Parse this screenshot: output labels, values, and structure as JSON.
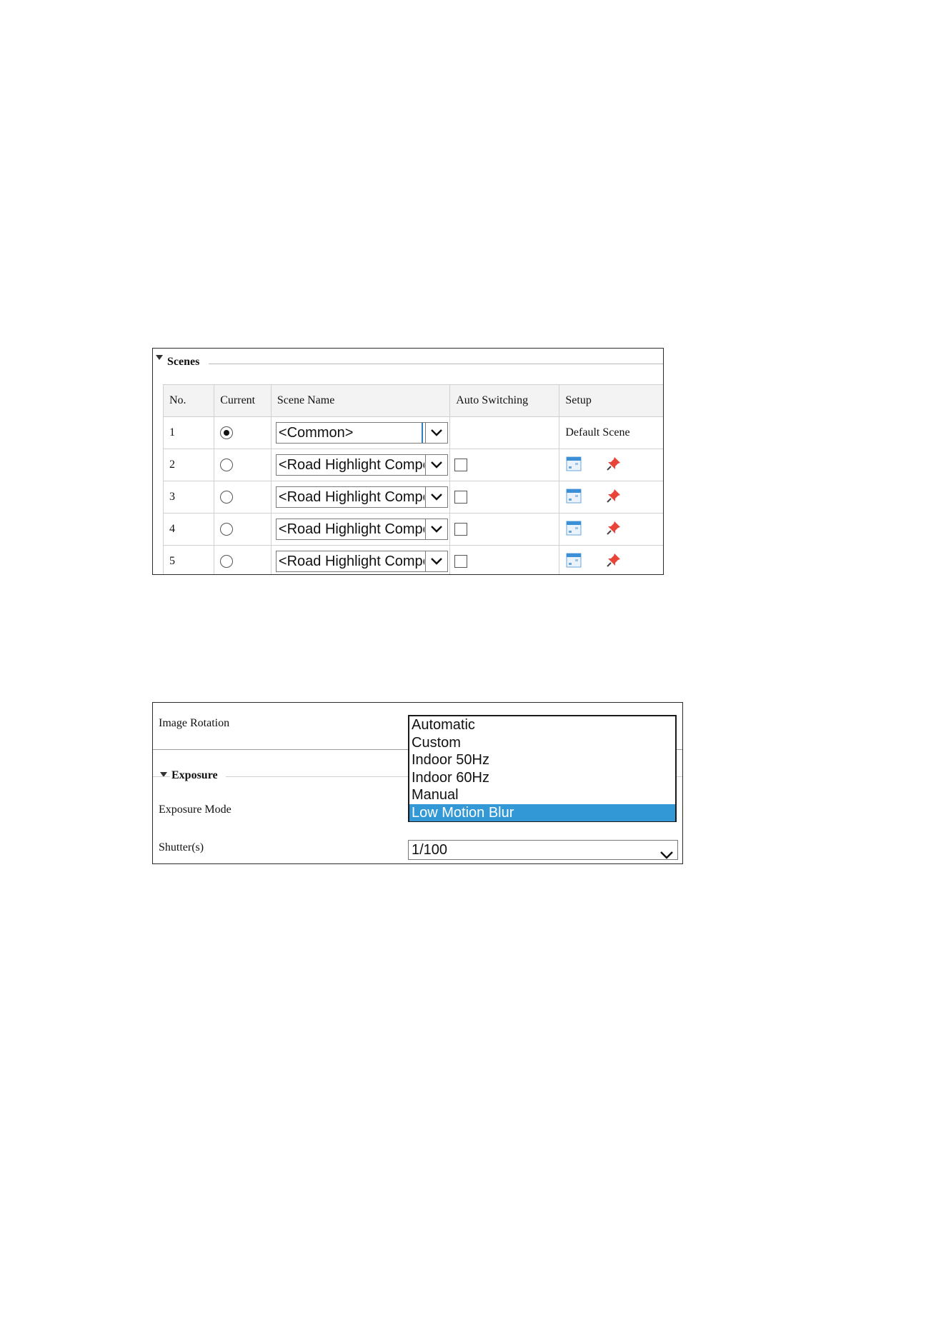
{
  "scenes": {
    "section_title": "Scenes",
    "columns": [
      "No.",
      "Current",
      "Scene Name",
      "Auto Switching",
      "Setup"
    ],
    "rows": [
      {
        "no": "1",
        "selected": true,
        "scene": "<Common>",
        "auto_switching": null,
        "setup_text": "Default Scene"
      },
      {
        "no": "2",
        "selected": false,
        "scene": "<Road Highlight Compensation>",
        "auto_switching": false,
        "setup_icons": [
          "calendar-icon",
          "pin-icon"
        ]
      },
      {
        "no": "3",
        "selected": false,
        "scene": "<Road Highlight Compensation>",
        "auto_switching": false,
        "setup_icons": [
          "calendar-icon",
          "pin-icon"
        ]
      },
      {
        "no": "4",
        "selected": false,
        "scene": "<Road Highlight Compensation>",
        "auto_switching": false,
        "setup_icons": [
          "calendar-icon",
          "pin-icon"
        ]
      },
      {
        "no": "5",
        "selected": false,
        "scene": "<Road Highlight Compensation>",
        "auto_switching": false,
        "setup_icons": [
          "calendar-icon",
          "pin-icon"
        ]
      }
    ]
  },
  "exposure_panel": {
    "image_rotation_label": "Image Rotation",
    "section_title": "Exposure",
    "exposure_mode_label": "Exposure Mode",
    "shutter_label": "Shutter(s)",
    "exposure_mode_options": [
      "Automatic",
      "Custom",
      "Indoor 50Hz",
      "Indoor 60Hz",
      "Manual",
      "Low Motion Blur"
    ],
    "exposure_mode_highlighted": "Low Motion Blur",
    "shutter_value": "1/100"
  },
  "colors": {
    "highlight": "#3399d6",
    "pin": "#e8443a",
    "calendar": "#3a8fd6"
  }
}
